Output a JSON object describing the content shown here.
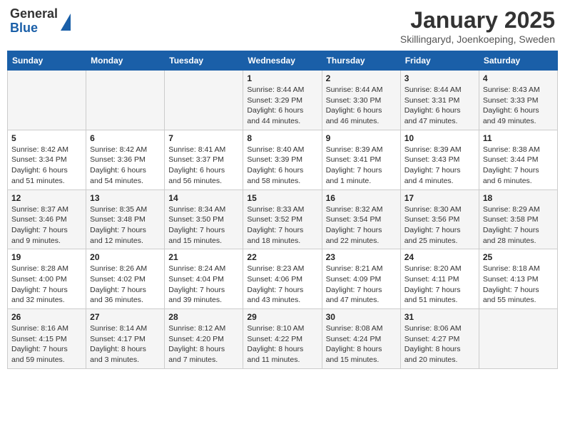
{
  "header": {
    "logo_general": "General",
    "logo_blue": "Blue",
    "month_title": "January 2025",
    "location": "Skillingaryd, Joenkoeping, Sweden"
  },
  "weekdays": [
    "Sunday",
    "Monday",
    "Tuesday",
    "Wednesday",
    "Thursday",
    "Friday",
    "Saturday"
  ],
  "weeks": [
    [
      {
        "day": "",
        "info": ""
      },
      {
        "day": "",
        "info": ""
      },
      {
        "day": "",
        "info": ""
      },
      {
        "day": "1",
        "info": "Sunrise: 8:44 AM\nSunset: 3:29 PM\nDaylight: 6 hours\nand 44 minutes."
      },
      {
        "day": "2",
        "info": "Sunrise: 8:44 AM\nSunset: 3:30 PM\nDaylight: 6 hours\nand 46 minutes."
      },
      {
        "day": "3",
        "info": "Sunrise: 8:44 AM\nSunset: 3:31 PM\nDaylight: 6 hours\nand 47 minutes."
      },
      {
        "day": "4",
        "info": "Sunrise: 8:43 AM\nSunset: 3:33 PM\nDaylight: 6 hours\nand 49 minutes."
      }
    ],
    [
      {
        "day": "5",
        "info": "Sunrise: 8:42 AM\nSunset: 3:34 PM\nDaylight: 6 hours\nand 51 minutes."
      },
      {
        "day": "6",
        "info": "Sunrise: 8:42 AM\nSunset: 3:36 PM\nDaylight: 6 hours\nand 54 minutes."
      },
      {
        "day": "7",
        "info": "Sunrise: 8:41 AM\nSunset: 3:37 PM\nDaylight: 6 hours\nand 56 minutes."
      },
      {
        "day": "8",
        "info": "Sunrise: 8:40 AM\nSunset: 3:39 PM\nDaylight: 6 hours\nand 58 minutes."
      },
      {
        "day": "9",
        "info": "Sunrise: 8:39 AM\nSunset: 3:41 PM\nDaylight: 7 hours\nand 1 minute."
      },
      {
        "day": "10",
        "info": "Sunrise: 8:39 AM\nSunset: 3:43 PM\nDaylight: 7 hours\nand 4 minutes."
      },
      {
        "day": "11",
        "info": "Sunrise: 8:38 AM\nSunset: 3:44 PM\nDaylight: 7 hours\nand 6 minutes."
      }
    ],
    [
      {
        "day": "12",
        "info": "Sunrise: 8:37 AM\nSunset: 3:46 PM\nDaylight: 7 hours\nand 9 minutes."
      },
      {
        "day": "13",
        "info": "Sunrise: 8:35 AM\nSunset: 3:48 PM\nDaylight: 7 hours\nand 12 minutes."
      },
      {
        "day": "14",
        "info": "Sunrise: 8:34 AM\nSunset: 3:50 PM\nDaylight: 7 hours\nand 15 minutes."
      },
      {
        "day": "15",
        "info": "Sunrise: 8:33 AM\nSunset: 3:52 PM\nDaylight: 7 hours\nand 18 minutes."
      },
      {
        "day": "16",
        "info": "Sunrise: 8:32 AM\nSunset: 3:54 PM\nDaylight: 7 hours\nand 22 minutes."
      },
      {
        "day": "17",
        "info": "Sunrise: 8:30 AM\nSunset: 3:56 PM\nDaylight: 7 hours\nand 25 minutes."
      },
      {
        "day": "18",
        "info": "Sunrise: 8:29 AM\nSunset: 3:58 PM\nDaylight: 7 hours\nand 28 minutes."
      }
    ],
    [
      {
        "day": "19",
        "info": "Sunrise: 8:28 AM\nSunset: 4:00 PM\nDaylight: 7 hours\nand 32 minutes."
      },
      {
        "day": "20",
        "info": "Sunrise: 8:26 AM\nSunset: 4:02 PM\nDaylight: 7 hours\nand 36 minutes."
      },
      {
        "day": "21",
        "info": "Sunrise: 8:24 AM\nSunset: 4:04 PM\nDaylight: 7 hours\nand 39 minutes."
      },
      {
        "day": "22",
        "info": "Sunrise: 8:23 AM\nSunset: 4:06 PM\nDaylight: 7 hours\nand 43 minutes."
      },
      {
        "day": "23",
        "info": "Sunrise: 8:21 AM\nSunset: 4:09 PM\nDaylight: 7 hours\nand 47 minutes."
      },
      {
        "day": "24",
        "info": "Sunrise: 8:20 AM\nSunset: 4:11 PM\nDaylight: 7 hours\nand 51 minutes."
      },
      {
        "day": "25",
        "info": "Sunrise: 8:18 AM\nSunset: 4:13 PM\nDaylight: 7 hours\nand 55 minutes."
      }
    ],
    [
      {
        "day": "26",
        "info": "Sunrise: 8:16 AM\nSunset: 4:15 PM\nDaylight: 7 hours\nand 59 minutes."
      },
      {
        "day": "27",
        "info": "Sunrise: 8:14 AM\nSunset: 4:17 PM\nDaylight: 8 hours\nand 3 minutes."
      },
      {
        "day": "28",
        "info": "Sunrise: 8:12 AM\nSunset: 4:20 PM\nDaylight: 8 hours\nand 7 minutes."
      },
      {
        "day": "29",
        "info": "Sunrise: 8:10 AM\nSunset: 4:22 PM\nDaylight: 8 hours\nand 11 minutes."
      },
      {
        "day": "30",
        "info": "Sunrise: 8:08 AM\nSunset: 4:24 PM\nDaylight: 8 hours\nand 15 minutes."
      },
      {
        "day": "31",
        "info": "Sunrise: 8:06 AM\nSunset: 4:27 PM\nDaylight: 8 hours\nand 20 minutes."
      },
      {
        "day": "",
        "info": ""
      }
    ]
  ]
}
